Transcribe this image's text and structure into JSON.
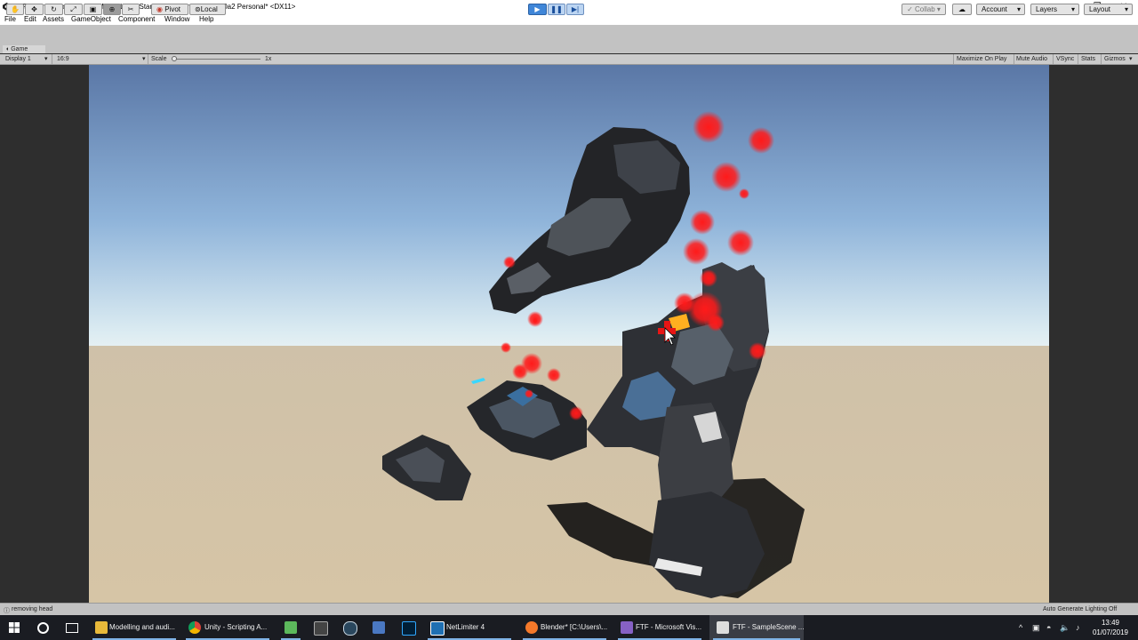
{
  "window": {
    "title": "FTF - SampleScene - PC, Mac & Linux Standalone - Unity 2019.3.0a2 Personal* <DX11>",
    "controls": {
      "minimize": "—",
      "restore": "❐",
      "close": "✕"
    }
  },
  "menu": [
    "File",
    "Edit",
    "Assets",
    "GameObject",
    "Component",
    "Window",
    "Help"
  ],
  "toolbar": {
    "pivot": "Pivot",
    "local": "Local",
    "collab": "Collab ▾",
    "account": "Account",
    "layers": "Layers",
    "layout": "Layout",
    "play_active": true
  },
  "game_view": {
    "tab_label": "Game",
    "display": "Display 1",
    "aspect": "16:9",
    "scale_label": "Scale",
    "scale_value": "1x",
    "maximize_on_play": "Maximize On Play",
    "mute_audio": "Mute Audio",
    "vsync": "VSync",
    "stats": "Stats",
    "gizmos": "Gizmos"
  },
  "status": {
    "message": "removing head",
    "right": "Auto Generate Lighting Off"
  },
  "taskbar": {
    "items": [
      {
        "label": "Modelling and audi...",
        "icon": "folder-icon",
        "color": "#e8b93a"
      },
      {
        "label": "Unity - Scripting A...",
        "icon": "chrome-icon",
        "color": "#db4437"
      },
      {
        "label": "",
        "icon": "notepad-icon",
        "color": "#5cb85c"
      },
      {
        "label": "",
        "icon": "calculator-icon",
        "color": "#888888"
      },
      {
        "label": "",
        "icon": "steam-icon",
        "color": "#2a475e"
      },
      {
        "label": "",
        "icon": "document-icon",
        "color": "#4a78c2"
      },
      {
        "label": "",
        "icon": "photoshop-icon",
        "color": "#31a8ff"
      },
      {
        "label": "NetLimiter 4",
        "icon": "netlimiter-icon",
        "color": "#1f6fb2"
      },
      {
        "label": "Blender* [C:\\Users\\...",
        "icon": "blender-icon",
        "color": "#f5792a"
      },
      {
        "label": "FTF - Microsoft Vis...",
        "icon": "visualstudio-icon",
        "color": "#8661c5"
      },
      {
        "label": "FTF - SampleScene ...",
        "icon": "unity-icon",
        "color": "#dddddd"
      }
    ],
    "time": "13:49",
    "date": "01/07/2019"
  },
  "colors": {
    "sky_top": "#5778a8",
    "sky_horizon": "#d4e6ef",
    "ground": "#d2c2a5",
    "blood": "#ff1a1a"
  }
}
